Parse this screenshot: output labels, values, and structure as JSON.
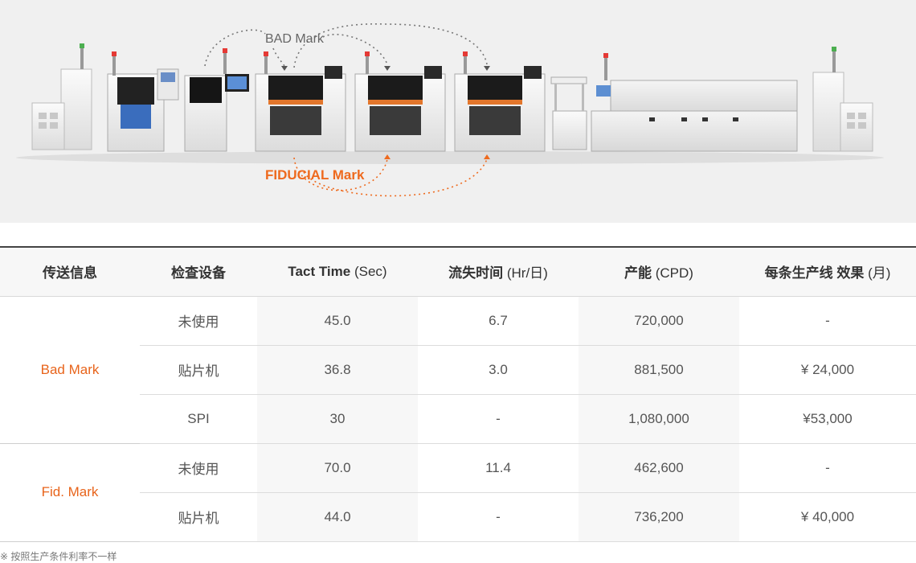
{
  "diagram": {
    "bad_mark_label": "BAD Mark",
    "fiducial_mark_label": "FIDUCIAL Mark",
    "colors": {
      "bad": "#777777",
      "fiducial": "#ee6a1e"
    }
  },
  "table": {
    "headers": [
      {
        "main": "传送信息",
        "unit": ""
      },
      {
        "main": "检查设备",
        "unit": ""
      },
      {
        "main": "Tact Time",
        "unit": " (Sec)"
      },
      {
        "main": "流失时间",
        "unit": " (Hr/日)"
      },
      {
        "main": "产能",
        "unit": " (CPD)"
      },
      {
        "main": "每条生产线 效果",
        "unit": " (月)"
      }
    ],
    "groups": [
      {
        "name": "Bad Mark",
        "rows": [
          [
            "未使用",
            "45.0",
            "6.7",
            "720,000",
            "-"
          ],
          [
            "贴片机",
            "36.8",
            "3.0",
            "881,500",
            "¥ 24,000"
          ],
          [
            "SPI",
            "30",
            "-",
            "1,080,000",
            "¥53,000"
          ]
        ]
      },
      {
        "name": "Fid. Mark",
        "rows": [
          [
            "未使用",
            "70.0",
            "11.4",
            "462,600",
            "-"
          ],
          [
            "贴片机",
            "44.0",
            "-",
            "736,200",
            "¥ 40,000"
          ]
        ]
      }
    ],
    "accent_color": "#e8641b"
  },
  "footnote": "※ 按照生产条件利率不一样"
}
